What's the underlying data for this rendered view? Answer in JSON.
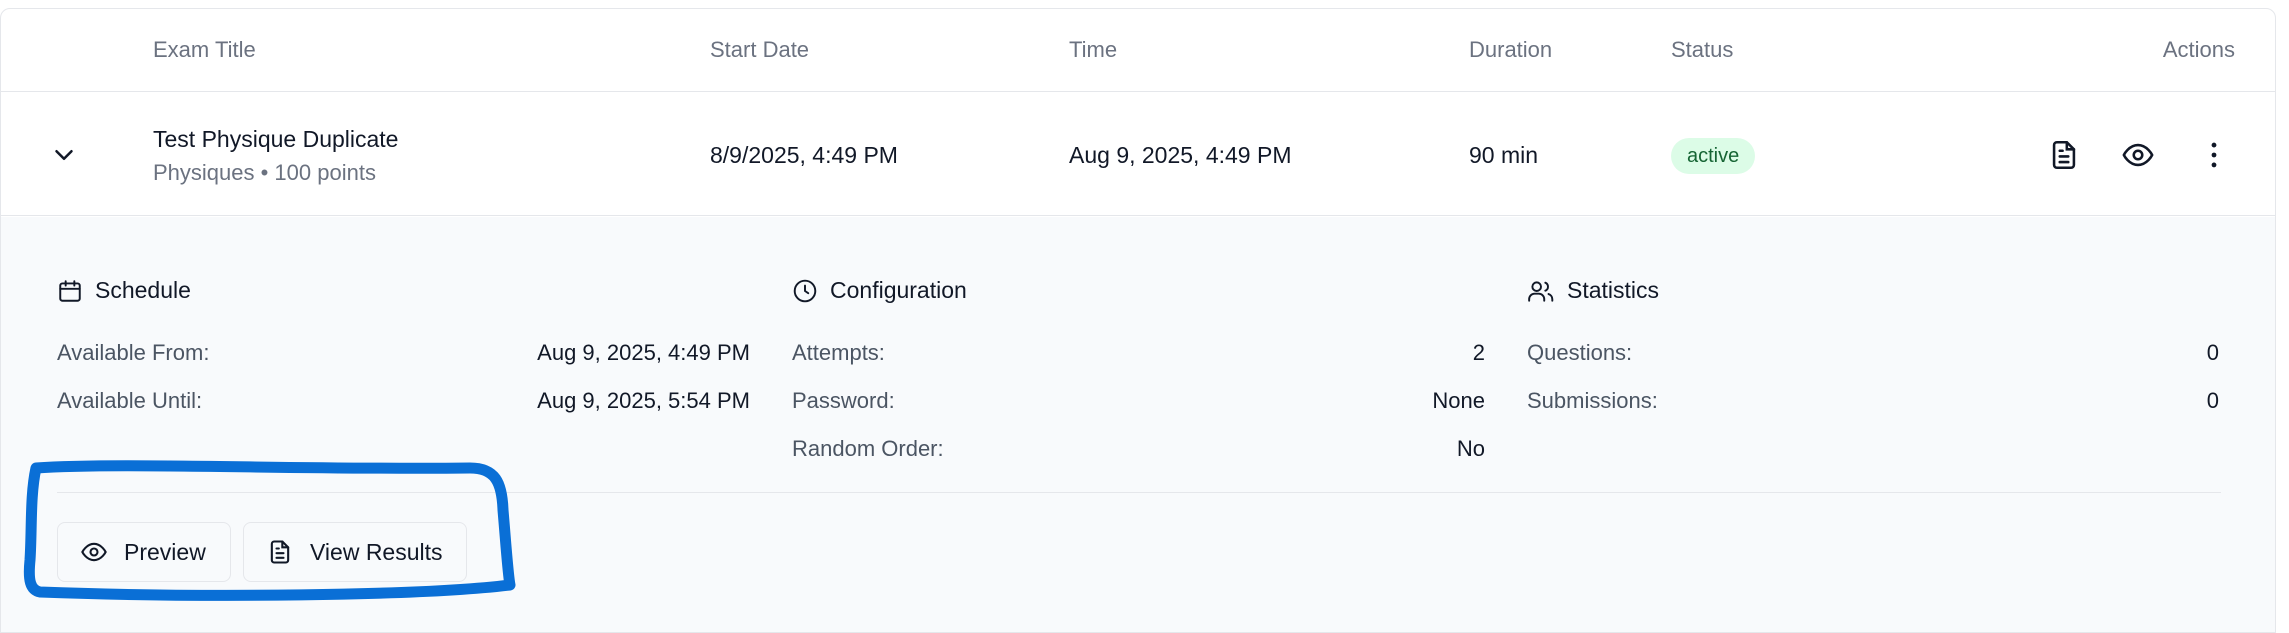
{
  "header": {
    "exam_title": "Exam Title",
    "start_date": "Start Date",
    "time": "Time",
    "duration": "Duration",
    "status": "Status",
    "actions": "Actions"
  },
  "row": {
    "title": "Test Physique Duplicate",
    "subtitle": "Physiques • 100 points",
    "start_date": "8/9/2025, 4:49 PM",
    "time": "Aug 9, 2025, 4:49 PM",
    "duration": "90 min",
    "status": "active"
  },
  "details": {
    "schedule": {
      "heading": "Schedule",
      "available_from_label": "Available From:",
      "available_from_value": "Aug 9, 2025, 4:49 PM",
      "available_until_label": "Available Until:",
      "available_until_value": "Aug 9, 2025, 5:54 PM"
    },
    "configuration": {
      "heading": "Configuration",
      "attempts_label": "Attempts:",
      "attempts_value": "2",
      "password_label": "Password:",
      "password_value": "None",
      "random_order_label": "Random Order:",
      "random_order_value": "No"
    },
    "statistics": {
      "heading": "Statistics",
      "questions_label": "Questions:",
      "questions_value": "0",
      "submissions_label": "Submissions:",
      "submissions_value": "0"
    }
  },
  "buttons": {
    "preview": "Preview",
    "view_results": "View Results"
  },
  "colors": {
    "status_bg": "#dcfce7",
    "status_text": "#166534",
    "annotation": "#0a6fd6"
  }
}
